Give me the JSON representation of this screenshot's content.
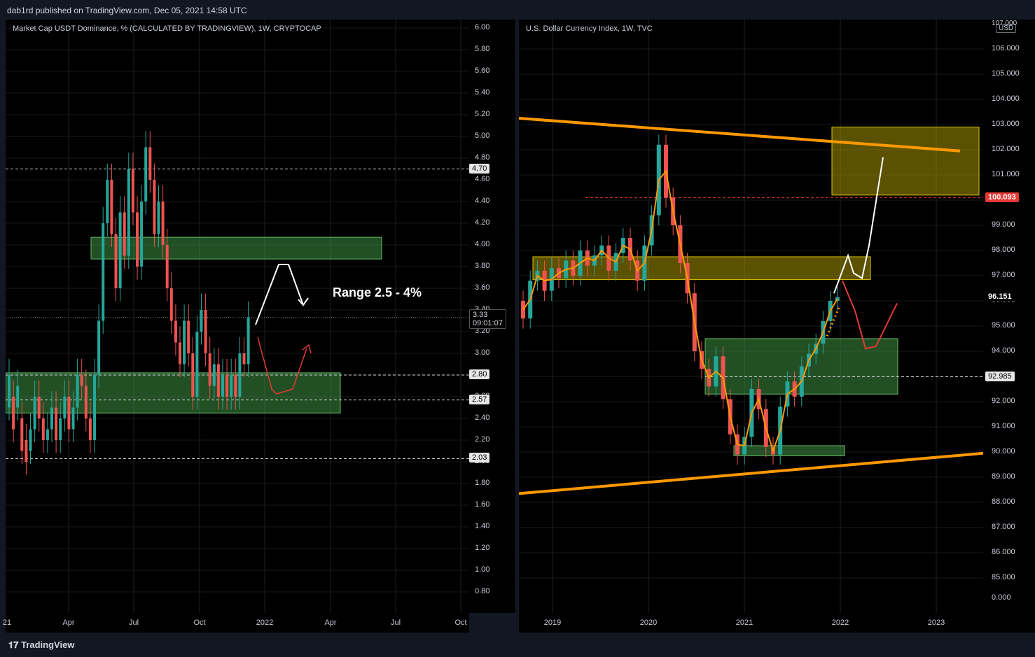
{
  "header": {
    "published": "dab1rd published on TradingView.com, Dec 05, 2021 14:58 UTC"
  },
  "footer": {
    "logo": "TradingView",
    "logo_icon": "tradingview-logo-icon"
  },
  "left": {
    "title": "Market Cap USDT Dominance, % (CALCULATED BY TRADINGVIEW), 1W, CRYPTOCAP",
    "annotation": "Range 2.5 - 4%",
    "last_price": "3.33",
    "countdown": "09:01:07",
    "tags": [
      "4.70",
      "2.80",
      "2.57",
      "2.03"
    ]
  },
  "right": {
    "title": "U.S. Dollar Currency Index, 1W, TVC",
    "currency": "USD",
    "last_price": "96.151",
    "tags": [
      "100.093",
      "92.985"
    ],
    "top_label": "107.000"
  },
  "colors": {
    "background": "#000000",
    "bull": "#26a69a",
    "bear": "#ef5350",
    "zone_green": "#4caf50",
    "zone_yellow": "#c9b400",
    "trendline": "#ff9800",
    "red_tag": "#e53935"
  },
  "chart_data": [
    {
      "type": "candlestick",
      "title": "Market Cap USDT Dominance, % (CALCULATED BY TRADINGVIEW), 1W, CRYPTOCAP",
      "x_ticks": [
        "21",
        "Apr",
        "Jul",
        "Oct",
        "2022",
        "Apr",
        "Jul",
        "Oct"
      ],
      "y_ticks": [
        "6.00",
        "5.80",
        "5.60",
        "5.40",
        "5.20",
        "5.00",
        "4.80",
        "4.60",
        "4.40",
        "4.20",
        "4.00",
        "3.80",
        "3.60",
        "3.40",
        "3.20",
        "3.00",
        "2.80",
        "2.60",
        "2.40",
        "2.20",
        "2.00",
        "1.80",
        "1.60",
        "1.40",
        "1.20",
        "1.00",
        "0.80"
      ],
      "ylim": [
        0.8,
        6.0
      ],
      "horizontal_levels": [
        4.7,
        2.8,
        2.57,
        2.03
      ],
      "last_value": 3.33,
      "zones": [
        {
          "color": "green",
          "from": 3.87,
          "to": 4.07
        },
        {
          "color": "green",
          "from": 2.45,
          "to": 2.82
        }
      ]
    },
    {
      "type": "candlestick",
      "title": "U.S. Dollar Currency Index, 1W, TVC",
      "x_ticks": [
        "2019",
        "2020",
        "2021",
        "2022",
        "2023"
      ],
      "y_ticks": [
        "106.000",
        "105.000",
        "104.000",
        "103.000",
        "102.000",
        "101.000",
        "100.000",
        "99.000",
        "98.000",
        "97.000",
        "96.000",
        "95.000",
        "94.000",
        "93.000",
        "92.000",
        "91.000",
        "90.000",
        "89.000",
        "88.000",
        "87.000",
        "86.000",
        "85.000",
        "0.000"
      ],
      "ylim": [
        85.0,
        107.0
      ],
      "horizontal_levels": [
        100.093,
        92.985
      ],
      "last_value": 96.151,
      "zones": [
        {
          "color": "yellow",
          "from": 96.85,
          "to": 97.75
        },
        {
          "color": "yellow",
          "from": 100.2,
          "to": 102.9
        },
        {
          "color": "green",
          "from": 92.3,
          "to": 94.5
        },
        {
          "color": "green",
          "from": 89.85,
          "to": 90.25
        }
      ]
    }
  ]
}
